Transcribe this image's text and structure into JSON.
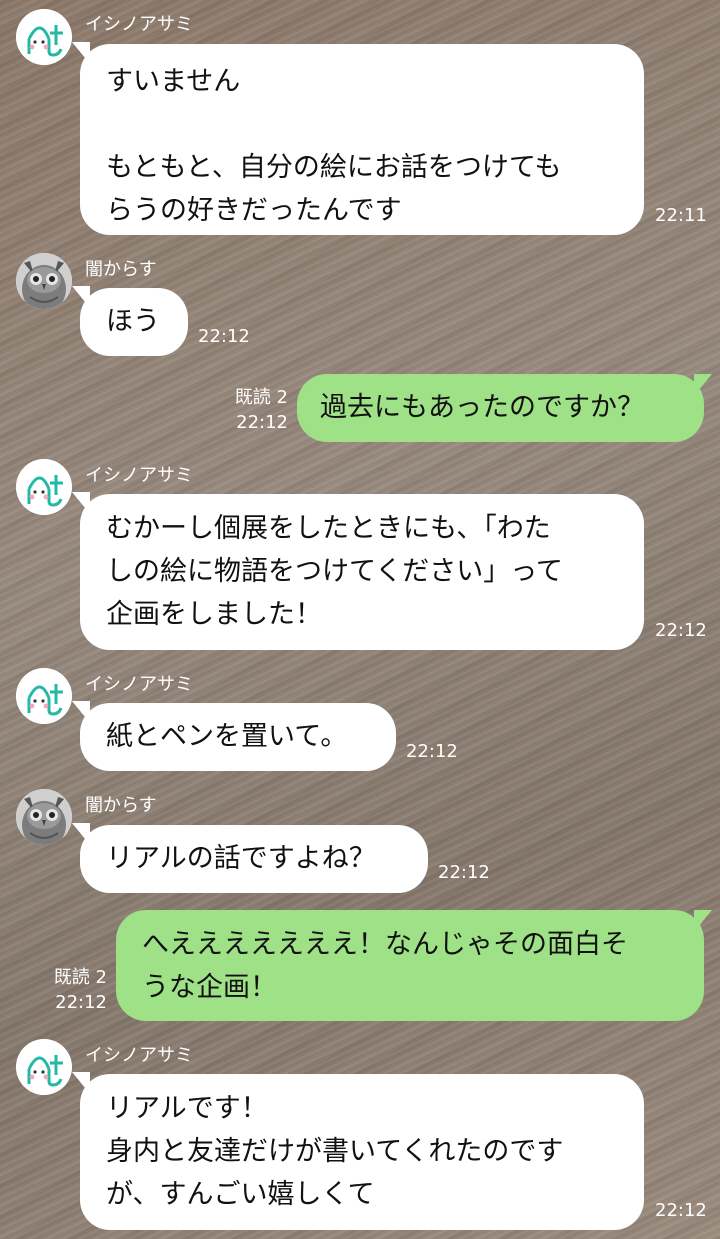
{
  "messages": [
    {
      "sender": "イシノアサミ",
      "avatar": "a-logo-icon",
      "text": "すいません\n\nもともと、自分の絵にお話をつけても\nらうの好きだったんです",
      "time": "22:11"
    },
    {
      "sender": "闇からす",
      "avatar": "owl-icon",
      "text": "ほう",
      "time": "22:12"
    },
    {
      "outgoing": true,
      "read": "既読 2",
      "text": "過去にもあったのですか？",
      "time": "22:12"
    },
    {
      "sender": "イシノアサミ",
      "avatar": "a-logo-icon",
      "text": "むかーし個展をしたときにも、「わた\nしの絵に物語をつけてください」って\n企画をしました！",
      "time": "22:12"
    },
    {
      "sender": "イシノアサミ",
      "avatar": "a-logo-icon",
      "text": "紙とペンを置いて。",
      "time": "22:12"
    },
    {
      "sender": "闇からす",
      "avatar": "owl-icon",
      "text": "リアルの話ですよね？",
      "time": "22:12"
    },
    {
      "outgoing": true,
      "read": "既読 2",
      "text": "へえええええええ！なんじゃその面白そ\nうな企画！",
      "time": "22:12"
    },
    {
      "sender": "イシノアサミ",
      "avatar": "a-logo-icon",
      "text": "リアルです！\n身内と友達だけが書いてくれたのです\nが、すんごい嬉しくて",
      "time": "22:12"
    }
  ],
  "colors": {
    "incoming_bubble": "#ffffff",
    "outgoing_bubble": "#9fe187",
    "background": "#8c7b6d",
    "avatar_accent": "#23b9a4"
  }
}
